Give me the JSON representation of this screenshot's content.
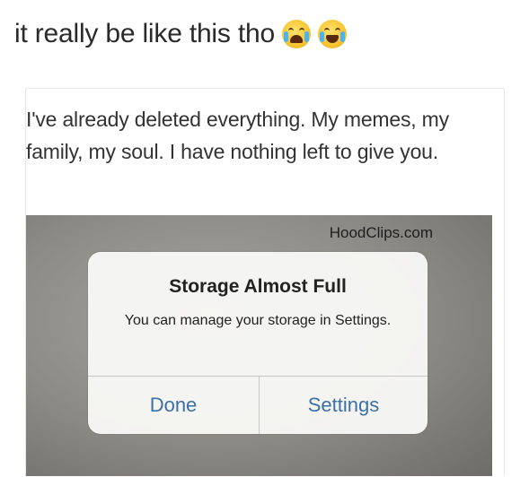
{
  "caption": {
    "text": "it really be like this tho",
    "emojis": [
      "loudly-crying-face-icon",
      "tears-of-joy-face-icon"
    ]
  },
  "post": {
    "text": "I've already deleted everything. My memes, my family, my soul. I have nothing left to give you."
  },
  "screenshot": {
    "watermark": "HoodClips.com",
    "alert": {
      "title": "Storage Almost Full",
      "message": "You can manage your storage in Settings.",
      "buttons": {
        "done": "Done",
        "settings": "Settings"
      },
      "button_color": "#3d6fa8"
    }
  }
}
